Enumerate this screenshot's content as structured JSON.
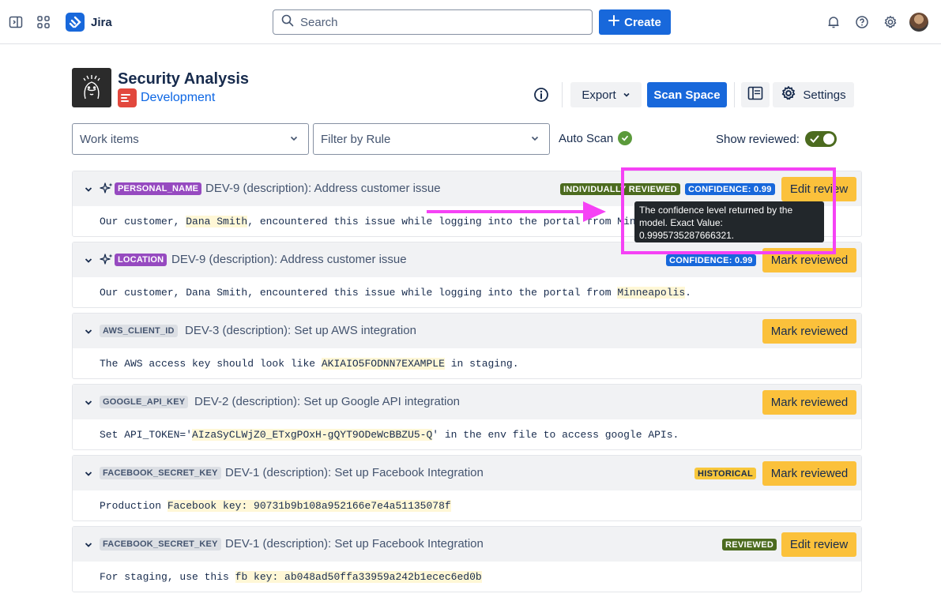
{
  "nav": {
    "app_name": "Jira",
    "search_placeholder": "Search",
    "create_label": "Create"
  },
  "header": {
    "title": "Security Analysis",
    "space_name": "Development",
    "export_label": "Export",
    "scan_label": "Scan Space",
    "settings_label": "Settings"
  },
  "filters": {
    "work_items": "Work items",
    "filter_rule": "Filter by Rule",
    "auto_scan": "Auto Scan",
    "show_reviewed": "Show reviewed:",
    "show_reviewed_on": true
  },
  "cards": [
    {
      "rule": "PERSONAL_NAME",
      "title": "DEV-9 (description): Address customer issue",
      "text_before": "Our customer, ",
      "highlight": "Dana Smith",
      "text_after": ", encountered this issue while logging into the portal from Minneapo",
      "status": "INDIVIDUALLY REVIEWED",
      "confidence": "CONFIDENCE: 0.99",
      "action": "Edit review"
    },
    {
      "rule": "LOCATION",
      "title": "DEV-9 (description): Address customer issue",
      "text_before": "Our customer, Dana Smith, encountered this issue while logging into the portal from ",
      "highlight": "Minneapolis",
      "text_after": ".",
      "confidence": "CONFIDENCE: 0.99",
      "action": "Mark reviewed"
    },
    {
      "rule": "AWS_CLIENT_ID",
      "title": "DEV-3 (description): Set up AWS integration",
      "text_before": "The AWS access key should look like ",
      "highlight": "AKIAIO5FODNN7EXAMPLE",
      "text_after": " in staging.",
      "action": "Mark reviewed"
    },
    {
      "rule": "GOOGLE_API_KEY",
      "title": "DEV-2 (description): Set up Google API integration",
      "text_before": "Set API_TOKEN='",
      "highlight": "AIzaSyCLWjZ0_ETxgPOxH-gQYT9ODeWcBBZU5-Q",
      "text_after": "' in the env file to access google APIs.",
      "action": "Mark reviewed"
    },
    {
      "rule": "FACEBOOK_SECRET_KEY",
      "title": "DEV-1 (description): Set up Facebook Integration",
      "text_before": "Production ",
      "highlight": "Facebook key: 90731b9b108a952166e7e4a51135078f",
      "text_after": "",
      "status": "HISTORICAL",
      "action": "Mark reviewed"
    },
    {
      "rule": "FACEBOOK_SECRET_KEY",
      "title": "DEV-1 (description): Set up Facebook Integration",
      "text_before": "For staging, use this ",
      "highlight": "fb key: ab048ad50ffa33959a242b1ecec6ed0b",
      "text_after": "",
      "status": "REVIEWED",
      "action": "Edit review"
    }
  ],
  "tooltip": {
    "text": "The confidence level returned by the model. Exact Value: 0.9995735287666321."
  },
  "colors": {
    "brand_blue": "#1868db",
    "action_yellow": "#fbc13b",
    "reviewed_green": "#4c6b1f",
    "rule_purple": "#964ac0",
    "annotation_magenta": "#f542f5"
  }
}
